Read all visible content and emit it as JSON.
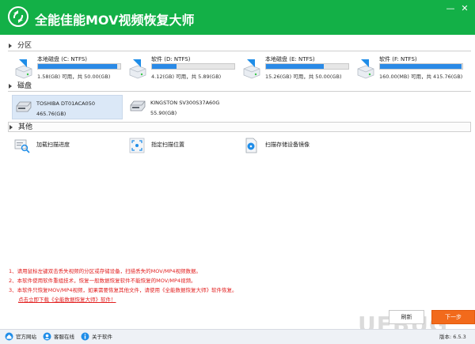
{
  "app": {
    "title": "全能佳能MOV视频恢复大师",
    "brand_color": "#13b047"
  },
  "window_controls": {
    "minimize": "—",
    "close": "✕"
  },
  "sections": {
    "partitions": "分区",
    "disks": "磁盘",
    "other": "其他"
  },
  "partitions": [
    {
      "name": "本地磁盘 (C: NTFS)",
      "info": "1.58(GB) 可用，共 50.00(GB)",
      "fill": 0.96
    },
    {
      "name": "软件 (D: NTFS)",
      "info": "4.12(GB) 可用，共 5.89(GB)",
      "fill": 0.3
    },
    {
      "name": "本地磁盘 (E: NTFS)",
      "info": "15.26(GB) 可用，共 50.00(GB)",
      "fill": 0.7
    },
    {
      "name": "软件 (F: NTFS)",
      "info": "160.00(MB) 可用，共 415.76(GB)",
      "fill": 0.99
    }
  ],
  "disks": [
    {
      "name": "TOSHIBA DT01ACA050",
      "size": "465.76(GB)"
    },
    {
      "name": "KINGSTON SV300S37A60G",
      "size": "55.90(GB)"
    }
  ],
  "actions": [
    {
      "label": "加载扫描进度",
      "icon": "load-progress-icon"
    },
    {
      "label": "指定扫描位置",
      "icon": "scan-location-icon"
    },
    {
      "label": "扫描存储设备镜像",
      "icon": "disk-image-icon"
    }
  ],
  "notes": [
    "1、请用鼠标左键双击丢失视频的分区或存储设备，扫描丢失的MOV/MP4视频数据。",
    "2、本软件使用软件重组技术，恢复一般数据恢复软件不能恢复的MOV/MP4视频。",
    "3、本软件只恢复MOV/MP4视频，如果需要恢复其他文件，请使用《全能数据恢复大师》软件恢复。"
  ],
  "note_link": "点击立即下载《全能数据恢复大师》软件！",
  "buttons": {
    "refresh": "刷新",
    "next": "下一步"
  },
  "status": {
    "website": "官方网站",
    "support": "客服在线",
    "about": "关于软件",
    "version": "版本: 6.5.3"
  },
  "watermark": "UEBUG",
  "colors": {
    "bar": "#2a8ae6",
    "note": "#e21f1f",
    "next_button": "#f26a1b"
  }
}
